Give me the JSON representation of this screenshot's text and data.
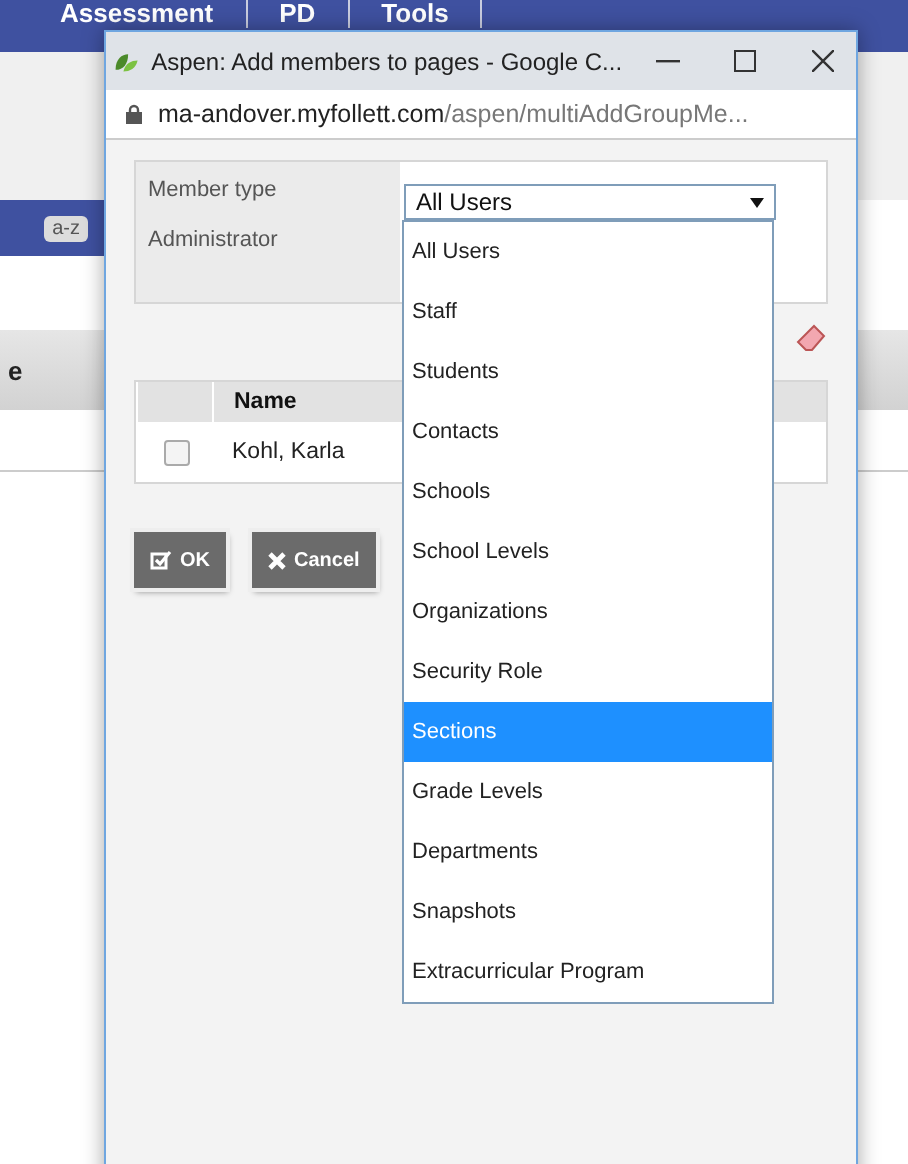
{
  "background_page": {
    "nav_items": [
      "Assessment",
      "PD",
      "Tools"
    ],
    "sort_button": "a-z",
    "column_header": "e"
  },
  "window": {
    "title": "Aspen: Add members to pages - Google C...",
    "address": {
      "host": "ma-andover.myfollett.com",
      "path": "/aspen/multiAddGroupMe..."
    }
  },
  "form": {
    "fields": [
      {
        "label": "Member type",
        "value": "All Users"
      },
      {
        "label": "Administrator"
      }
    ]
  },
  "dropdown": {
    "options": [
      {
        "label": "All Users",
        "selected": false
      },
      {
        "label": "Staff",
        "selected": false
      },
      {
        "label": "Students",
        "selected": false
      },
      {
        "label": "Contacts",
        "selected": false
      },
      {
        "label": "Schools",
        "selected": false
      },
      {
        "label": "School Levels",
        "selected": false
      },
      {
        "label": "Organizations",
        "selected": false
      },
      {
        "label": "Security Role",
        "selected": false
      },
      {
        "label": "Sections",
        "selected": true
      },
      {
        "label": "Grade Levels",
        "selected": false
      },
      {
        "label": "Departments",
        "selected": false
      },
      {
        "label": "Snapshots",
        "selected": false
      },
      {
        "label": "Extracurricular Program",
        "selected": false
      }
    ]
  },
  "table": {
    "columns": [
      "Name"
    ],
    "rows": [
      {
        "checked": false,
        "name": "Kohl, Karla"
      }
    ]
  },
  "buttons": [
    {
      "kind": "ok",
      "label": "OK"
    },
    {
      "kind": "cancel",
      "label": "Cancel"
    }
  ]
}
